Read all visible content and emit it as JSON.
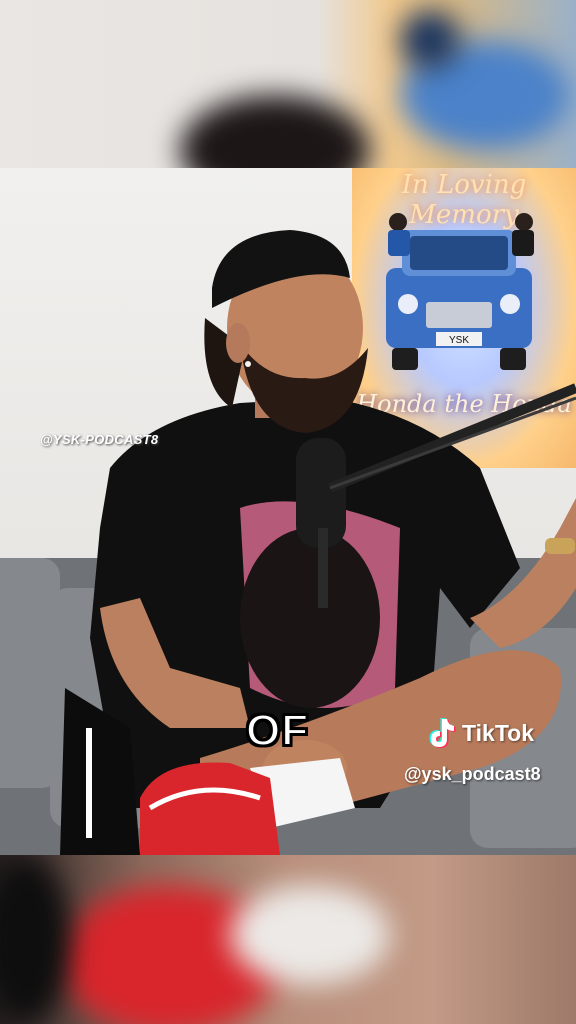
{
  "poster": {
    "title": "In Loving Memory",
    "footer": "Honda the Honda",
    "plate": "YSK"
  },
  "watermark": {
    "brand_tag": "@YSK-PODCAST8",
    "platform": "TikTok",
    "handle": "@ysk_podcast8"
  },
  "caption": {
    "word": "OF"
  },
  "colors": {
    "shirt": "#101010",
    "sneaker": "#d8262c",
    "car": "#3b6fc4"
  }
}
